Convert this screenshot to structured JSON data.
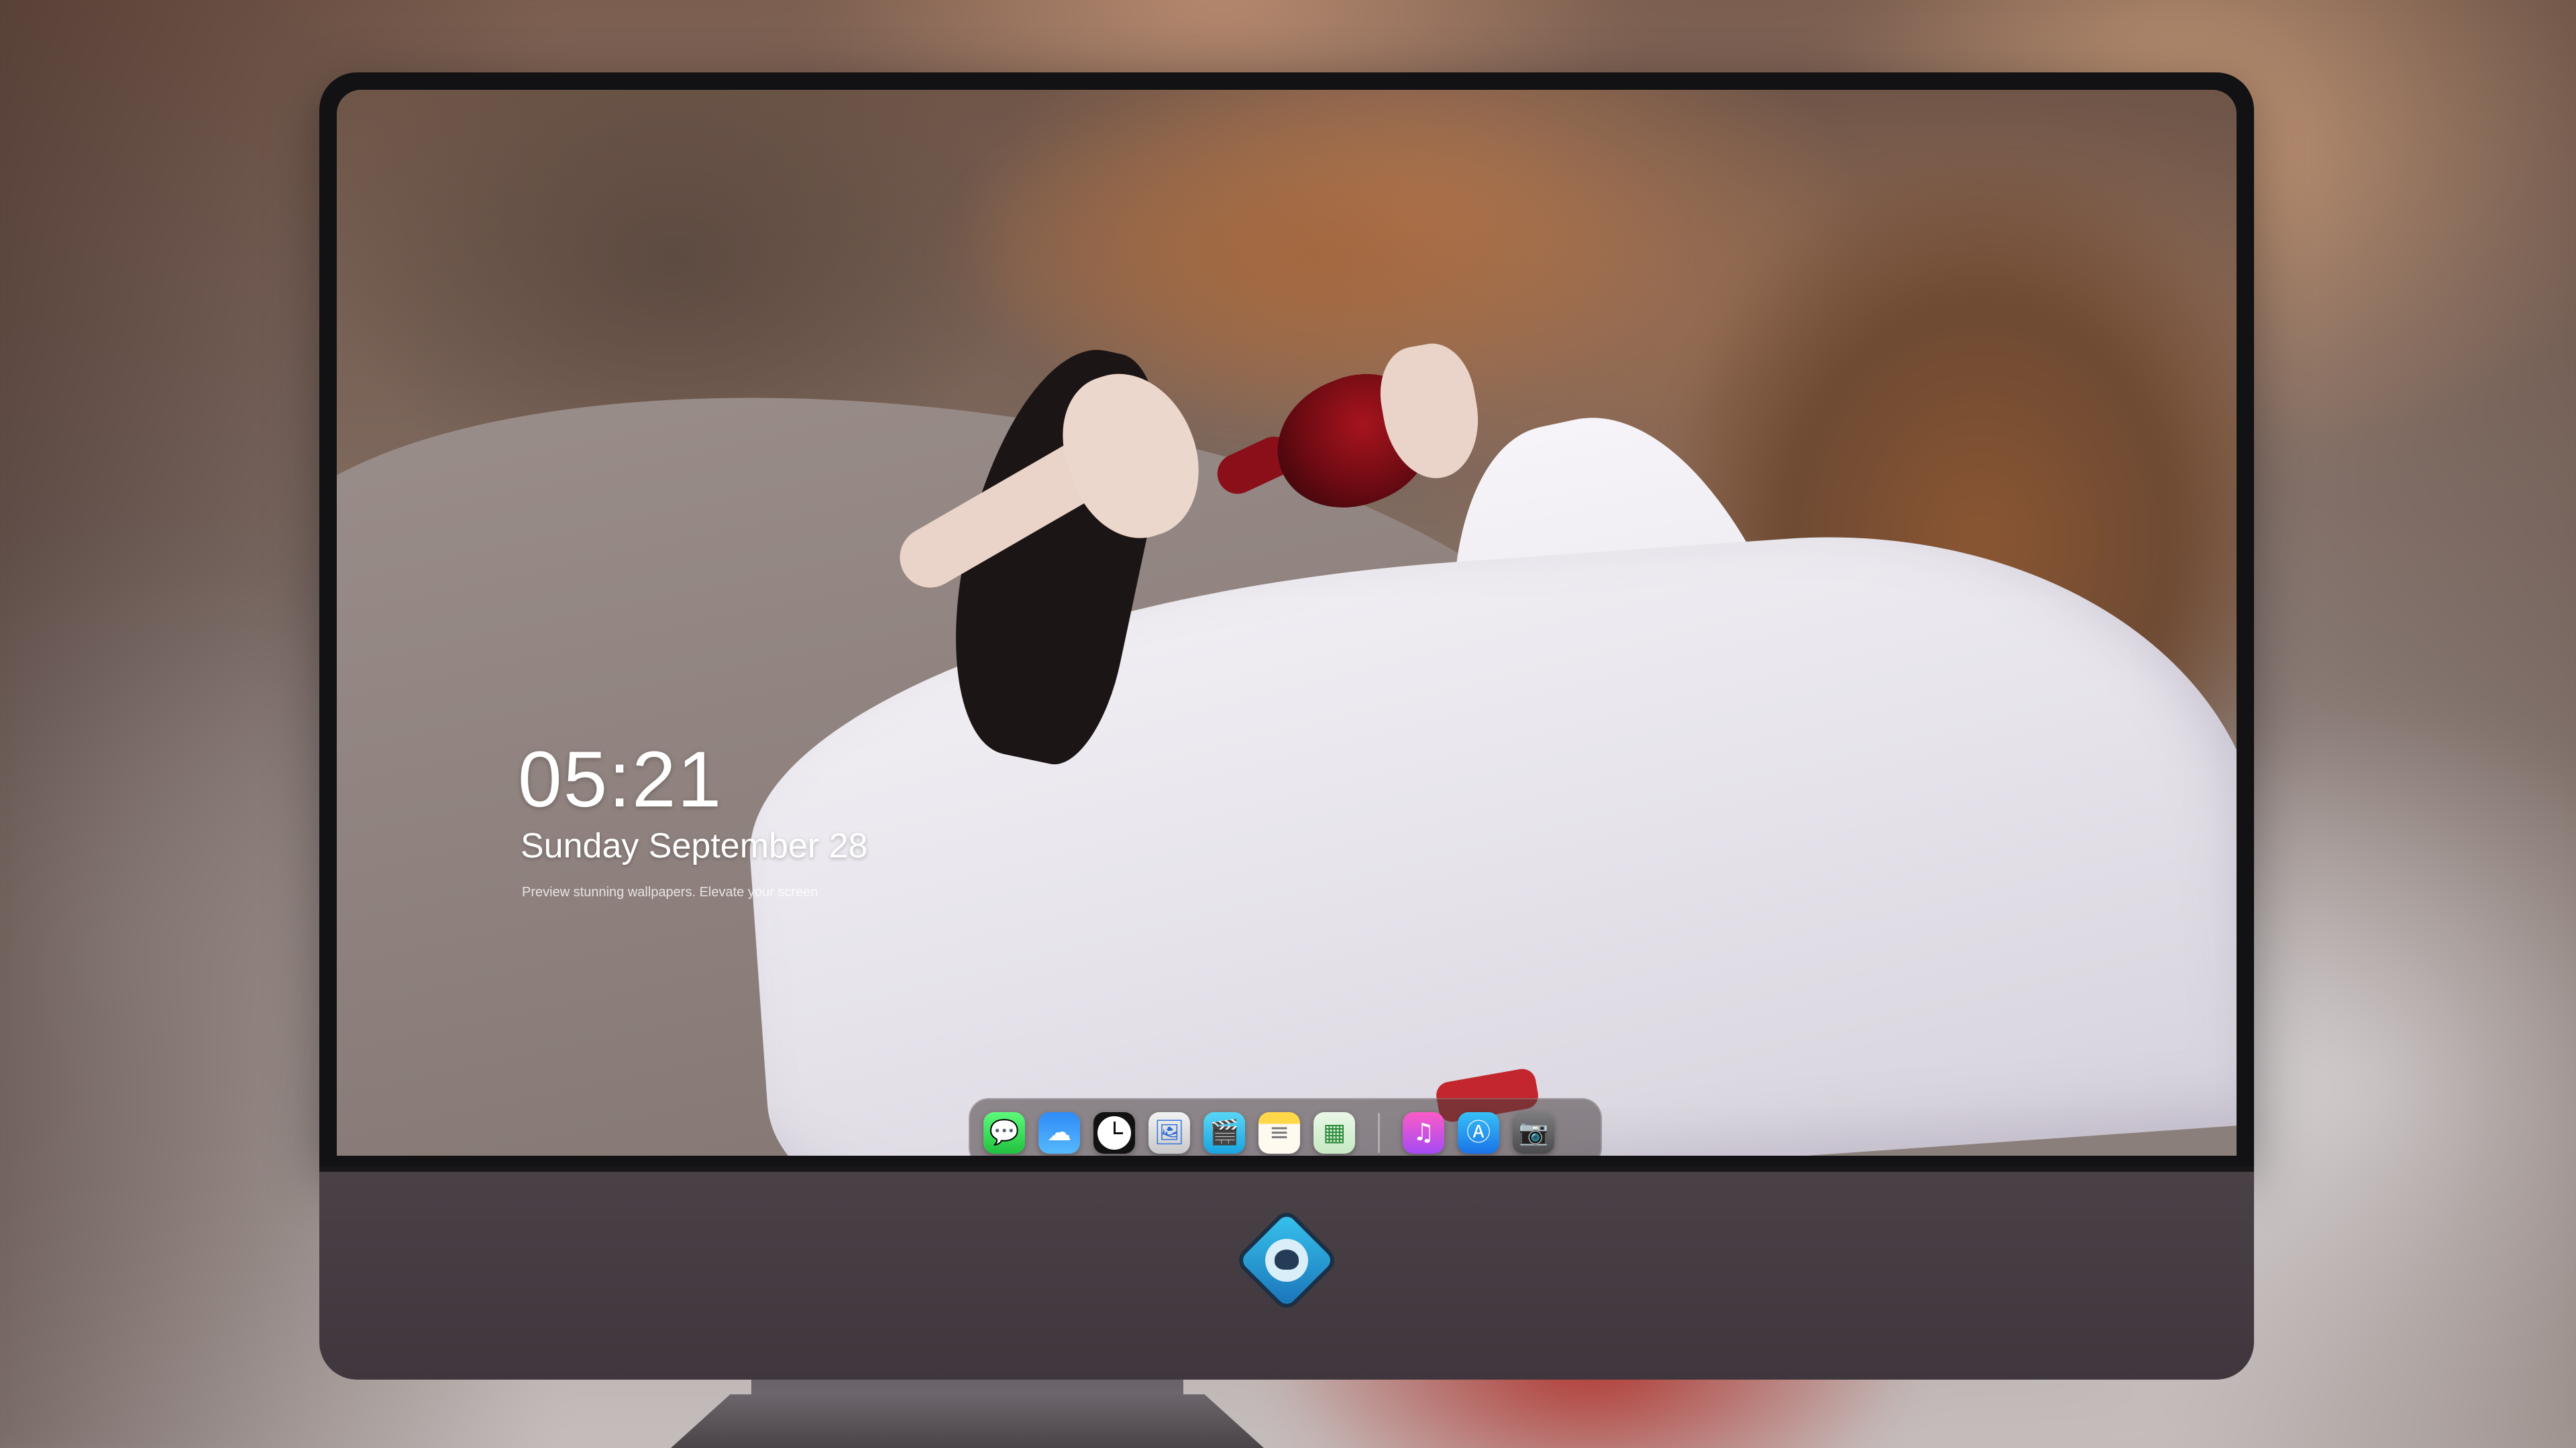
{
  "lock_screen": {
    "time": "05:21",
    "date": "Sunday September  28",
    "tagline": "Preview stunning wallpapers. Elevate your screen"
  },
  "dock": {
    "apps": [
      {
        "name": "Messages",
        "icon": "message-bubble-icon",
        "glyph": "💬",
        "color": "#21c23f"
      },
      {
        "name": "Weather",
        "icon": "cloud-sun-icon",
        "glyph": "☁",
        "color": "#2f8cf8"
      },
      {
        "name": "Clock",
        "icon": "clock-icon",
        "glyph": "",
        "color": "#111111"
      },
      {
        "name": "Preview",
        "icon": "preview-icon",
        "glyph": "🖼",
        "color": "#c8c8c8"
      },
      {
        "name": "Clips",
        "icon": "clapperboard-icon",
        "glyph": "🎬",
        "color": "#1aa3e0"
      },
      {
        "name": "Notes",
        "icon": "notes-icon",
        "glyph": "≡",
        "color": "#ffd84a"
      },
      {
        "name": "Numbers",
        "icon": "spreadsheet-icon",
        "glyph": "▦",
        "color": "#2c8a3a"
      },
      {
        "name": "Music",
        "icon": "music-note-icon",
        "glyph": "♫",
        "color": "#fb5cc6"
      },
      {
        "name": "App Store",
        "icon": "app-store-icon",
        "glyph": "Ⓐ",
        "color": "#1a73e8"
      },
      {
        "name": "Camera",
        "icon": "camera-icon",
        "glyph": "📷",
        "color": "#4b4b4e"
      }
    ]
  },
  "monitor": {
    "logo_icon": "mascot-logo-icon",
    "accent": "#37c4ee"
  }
}
